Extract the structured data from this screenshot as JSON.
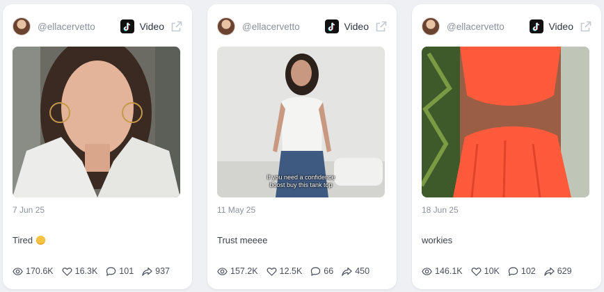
{
  "posts": [
    {
      "handle": "@ellacervetto",
      "platform": "Video",
      "platform_icon": "tiktok-icon",
      "date": "7 Jun 25",
      "caption": "Tired",
      "caption_emoji": "yawning-face-emoji",
      "overlay_text": "",
      "stats": {
        "views": "170.6K",
        "likes": "16.3K",
        "comments": "101",
        "shares": "937"
      }
    },
    {
      "handle": "@ellacervetto",
      "platform": "Video",
      "platform_icon": "tiktok-icon",
      "date": "11 May 25",
      "caption": "Trust meeee",
      "overlay_text": "If you need a confidence\nboost buy this tank top",
      "stats": {
        "views": "157.2K",
        "likes": "12.5K",
        "comments": "66",
        "shares": "450"
      }
    },
    {
      "handle": "@ellacervetto",
      "platform": "Video",
      "platform_icon": "tiktok-icon",
      "date": "18 Jun 25",
      "caption": "workies",
      "overlay_text": "",
      "stats": {
        "views": "146.1K",
        "likes": "10K",
        "comments": "102",
        "shares": "629"
      }
    }
  ],
  "colors": {
    "background": "#eef0f3",
    "card": "#ffffff",
    "muted_text": "#8a8f9a",
    "tiktok_logo": "#111111"
  }
}
